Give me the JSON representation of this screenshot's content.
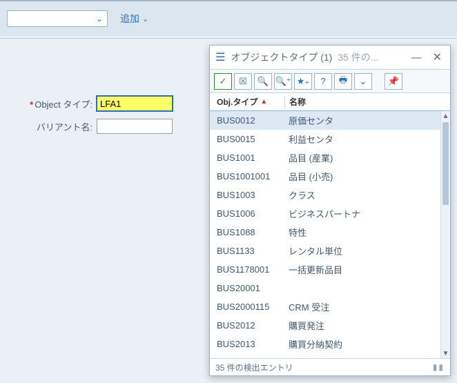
{
  "toolbar": {
    "combo_value": "",
    "add_label": "追加"
  },
  "form": {
    "object_type_label": "Object タイプ:",
    "object_type_value": "LFA1",
    "variant_label": "バリアント名:",
    "variant_value": ""
  },
  "popup": {
    "title": "オブジェクトタイプ (1)",
    "count_text": "35 件の...",
    "status_text": "35 件の検出エントリ",
    "headers": {
      "col1": "Obj.タイプ",
      "col2": "名称"
    },
    "rows": [
      {
        "id": "BUS0012",
        "name": "原価センタ",
        "selected": true
      },
      {
        "id": "BUS0015",
        "name": "利益センタ"
      },
      {
        "id": "BUS1001",
        "name": "品目 (産業)"
      },
      {
        "id": "BUS1001001",
        "name": "品目 (小売)"
      },
      {
        "id": "BUS1003",
        "name": "クラス"
      },
      {
        "id": "BUS1006",
        "name": "ビジネスパートナ"
      },
      {
        "id": "BUS1088",
        "name": "特性"
      },
      {
        "id": "BUS1133",
        "name": "レンタル単位"
      },
      {
        "id": "BUS1178001",
        "name": "一括更新品目"
      },
      {
        "id": "BUS20001",
        "name": ""
      },
      {
        "id": "BUS2000115",
        "name": "CRM 受注"
      },
      {
        "id": "BUS2012",
        "name": "購買発注"
      },
      {
        "id": "BUS2013",
        "name": "購買分納契約"
      }
    ]
  }
}
